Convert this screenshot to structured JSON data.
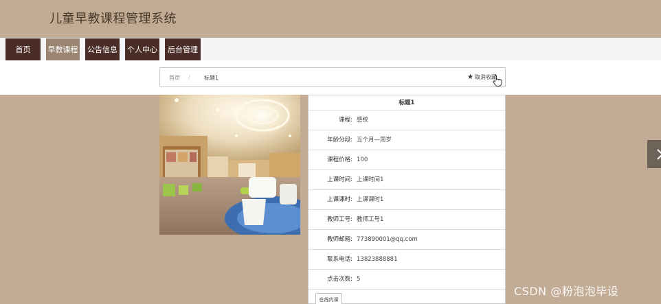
{
  "site": {
    "title": "儿童早教课程管理系统"
  },
  "nav": {
    "items": [
      {
        "label": "首页",
        "active": false
      },
      {
        "label": "早教课程",
        "active": true
      },
      {
        "label": "公告信息",
        "active": false
      },
      {
        "label": "个人中心",
        "active": false
      },
      {
        "label": "后台管理",
        "active": false
      }
    ]
  },
  "breadcrumb": {
    "home": "首页",
    "separator": "/",
    "current": "标题1",
    "favorite_label": "取消收藏"
  },
  "detail": {
    "title": "标题1",
    "rows": [
      {
        "label": "课程:",
        "value": "感统"
      },
      {
        "label": "年龄分段:",
        "value": "五个月—周岁"
      },
      {
        "label": "课程价格:",
        "value": "100"
      },
      {
        "label": "上课时间:",
        "value": "上课时间1"
      },
      {
        "label": "上课课时:",
        "value": "上课课时1"
      },
      {
        "label": "教师工号:",
        "value": "教师工号1"
      },
      {
        "label": "教师邮箱:",
        "value": "773890001@qq.com"
      },
      {
        "label": "联系电话:",
        "value": "13823888881"
      },
      {
        "label": "点击次数:",
        "value": "5"
      }
    ],
    "book_button": "在线约课"
  },
  "watermark": "CSDN @粉泡泡毕设",
  "colors": {
    "header_bg": "#c1ab93",
    "nav_bg": "#4b2d27",
    "nav_active_bg": "#9a8572",
    "content_bg": "#c2ac95"
  }
}
